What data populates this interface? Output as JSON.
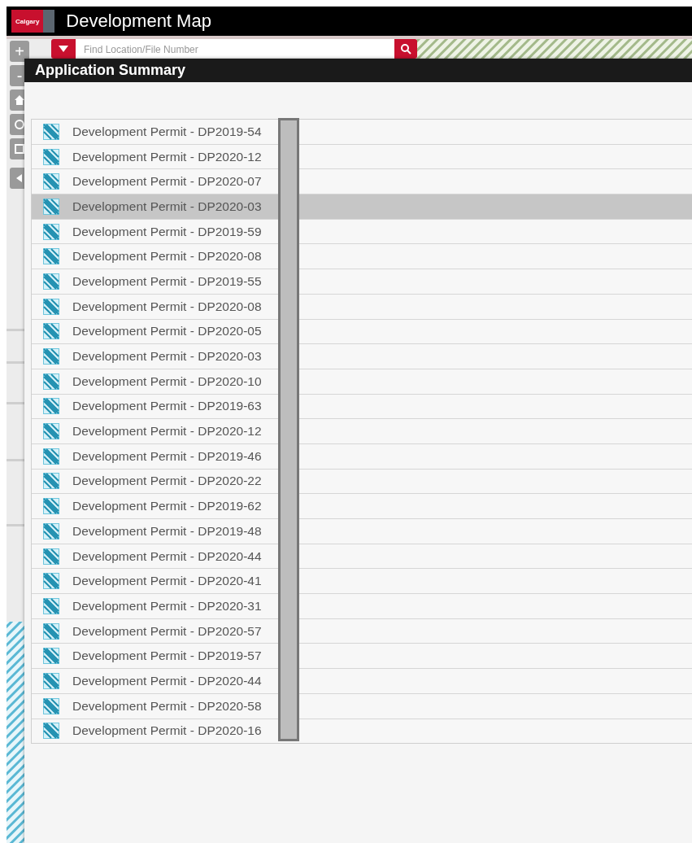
{
  "header": {
    "logo_text": "Calgary",
    "title": "Development Map"
  },
  "search": {
    "placeholder": "Find Location/File Number"
  },
  "map_controls": [
    {
      "kind": "zoom",
      "label": "+"
    },
    {
      "kind": "zoom",
      "label": "-"
    },
    {
      "kind": "home"
    },
    {
      "kind": "locate"
    },
    {
      "kind": "expand"
    },
    {
      "kind": "collapse"
    }
  ],
  "panel": {
    "title": "Application Summary",
    "items": [
      {
        "label": "Development Permit - DP2019-54",
        "selected": false
      },
      {
        "label": "Development Permit - DP2020-12",
        "selected": false
      },
      {
        "label": "Development Permit - DP2020-07",
        "selected": false
      },
      {
        "label": "Development Permit - DP2020-03",
        "selected": true
      },
      {
        "label": "Development Permit - DP2019-59",
        "selected": false
      },
      {
        "label": "Development Permit - DP2020-08",
        "selected": false
      },
      {
        "label": "Development Permit - DP2019-55",
        "selected": false
      },
      {
        "label": "Development Permit - DP2020-08",
        "selected": false
      },
      {
        "label": "Development Permit - DP2020-05",
        "selected": false
      },
      {
        "label": "Development Permit - DP2020-03",
        "selected": false
      },
      {
        "label": "Development Permit - DP2020-10",
        "selected": false
      },
      {
        "label": "Development Permit - DP2019-63",
        "selected": false
      },
      {
        "label": "Development Permit - DP2020-12",
        "selected": false
      },
      {
        "label": "Development Permit - DP2019-46",
        "selected": false
      },
      {
        "label": "Development Permit - DP2020-22",
        "selected": false
      },
      {
        "label": "Development Permit - DP2019-62",
        "selected": false
      },
      {
        "label": "Development Permit - DP2019-48",
        "selected": false
      },
      {
        "label": "Development Permit - DP2020-44",
        "selected": false
      },
      {
        "label": "Development Permit - DP2020-41",
        "selected": false
      },
      {
        "label": "Development Permit - DP2020-31",
        "selected": false
      },
      {
        "label": "Development Permit - DP2020-57",
        "selected": false
      },
      {
        "label": "Development Permit - DP2019-57",
        "selected": false
      },
      {
        "label": "Development Permit - DP2020-44",
        "selected": false
      },
      {
        "label": "Development Permit - DP2020-58",
        "selected": false
      },
      {
        "label": "Development Permit - DP2020-16",
        "selected": false
      }
    ]
  }
}
